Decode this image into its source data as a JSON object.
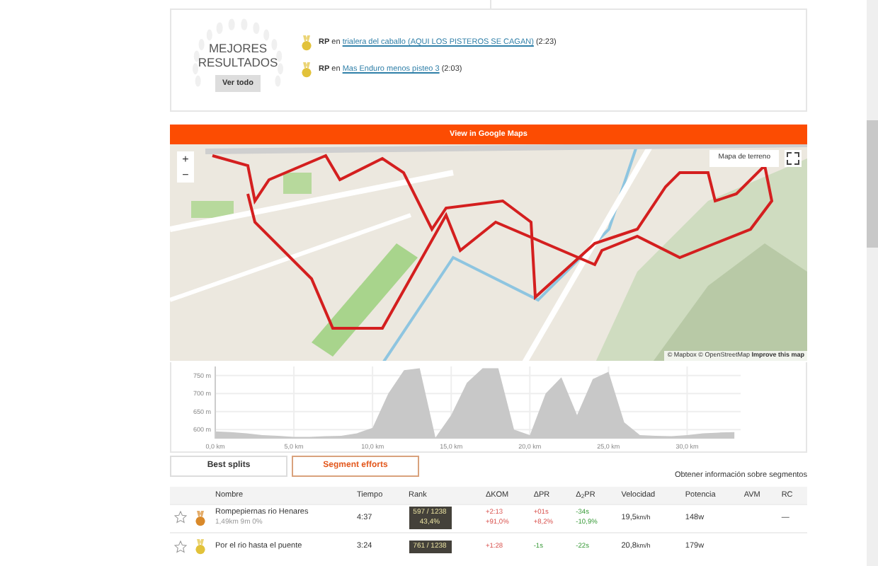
{
  "best_results": {
    "title": "MEJORES RESULTADOS",
    "button": "Ver todo",
    "items": [
      {
        "label": "RP",
        "connector": "en",
        "segment": "trialera del caballo (AQUI LOS PISTEROS SE CAGAN)",
        "time": "(2:23)"
      },
      {
        "label": "RP",
        "connector": "en",
        "segment": "Mas Enduro menos pisteo 3",
        "time": "(2:03)"
      }
    ]
  },
  "map": {
    "banner": "View in Google Maps",
    "zoom_in": "+",
    "zoom_out": "−",
    "layer_select": "Mapa de terreno",
    "attribution": "© Mapbox © OpenStreetMap",
    "improve_link": "Improve this map"
  },
  "elevation": {
    "chart_data": {
      "type": "area",
      "x": [
        0,
        1,
        2,
        3,
        4,
        5,
        6,
        7,
        8,
        9,
        10,
        11,
        12,
        13,
        14,
        15,
        16,
        17,
        18,
        19,
        20,
        21,
        22,
        23,
        24,
        25,
        26,
        27,
        28,
        29,
        30,
        31,
        32,
        33
      ],
      "grid": true,
      "series": [
        {
          "color": "#c8c8c8",
          "values": [
            595,
            593,
            590,
            585,
            583,
            580,
            580,
            582,
            583,
            590,
            605,
            700,
            765,
            770,
            578,
            640,
            730,
            770,
            770,
            600,
            585,
            700,
            745,
            640,
            740,
            760,
            620,
            585,
            583,
            582,
            585,
            590,
            592,
            593
          ]
        }
      ],
      "xlim": [
        0,
        33.4
      ],
      "ylim": [
        575,
        775
      ],
      "xticks": [
        {
          "value": 0,
          "label": "0,0 km"
        },
        {
          "value": 5,
          "label": "5,0 km"
        },
        {
          "value": 10,
          "label": "10,0 km"
        },
        {
          "value": 15,
          "label": "15,0 km"
        },
        {
          "value": 20,
          "label": "20,0 km"
        },
        {
          "value": 25,
          "label": "25,0 km"
        },
        {
          "value": 30,
          "label": "30,0 km"
        }
      ],
      "yticks": [
        {
          "value": 600,
          "label": "600 m"
        },
        {
          "value": 650,
          "label": "650 m"
        },
        {
          "value": 700,
          "label": "700 m"
        },
        {
          "value": 750,
          "label": "750 m"
        }
      ]
    }
  },
  "tabs": [
    {
      "label": "Best splits",
      "selected": false
    },
    {
      "label": "Segment efforts",
      "selected": true
    }
  ],
  "segments_link": "Obtener información sobre segmentos",
  "table": {
    "columns": [
      "Nombre",
      "Tiempo",
      "Rank",
      "ΔKOM",
      "ΔPR",
      "Δ$_{2}$PR",
      "Velocidad",
      "Potencia",
      "AVM",
      "RC"
    ],
    "rows": [
      {
        "starred": false,
        "color": "#d9892a",
        "name": "Rompepiernas rio Henares",
        "distance": "1,49km",
        "elevation": "9m",
        "grade": "0%",
        "time": "4:37",
        "rank": "597 / 1238",
        "rank_pct": "43,4%",
        "deltas": [
          {
            "time": "+2:13",
            "pct": "+91,0%",
            "better": false
          },
          {
            "time": "+01s",
            "pct": "+8,2%",
            "better": false
          },
          {
            "time": "-34s",
            "pct": "-10,9%",
            "better": true
          }
        ],
        "speed": "19,5",
        "speed_unit": "km/h",
        "power": "148w",
        "rc": "—"
      },
      {
        "starred": false,
        "color": "#e2c23a",
        "name": "Por el rio hasta el puente",
        "time": "3:24",
        "rank": "761 / 1238",
        "deltas": [
          {
            "time": "+1:28",
            "better": false
          },
          {
            "time": "-1s",
            "better": true
          },
          {
            "time": "-22s",
            "better": true
          }
        ],
        "speed": "20,8",
        "speed_unit": "km/h",
        "power": "179w"
      }
    ]
  }
}
